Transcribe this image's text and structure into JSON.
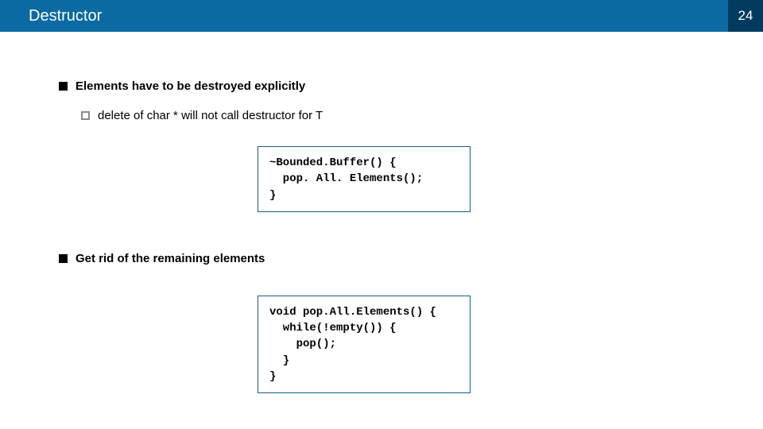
{
  "header": {
    "title": "Destructor",
    "page_number": "24"
  },
  "bullets": {
    "b1": "Elements have to be destroyed explicitly",
    "b1_sub": "delete of char * will not call destructor for T",
    "b2": "Get rid of the remaining elements"
  },
  "code": {
    "block1": "~Bounded.Buffer() {\n  pop. All. Elements();\n}",
    "block2": "void pop.All.Elements() {\n  while(!empty()) {\n    pop();\n  }\n}"
  }
}
